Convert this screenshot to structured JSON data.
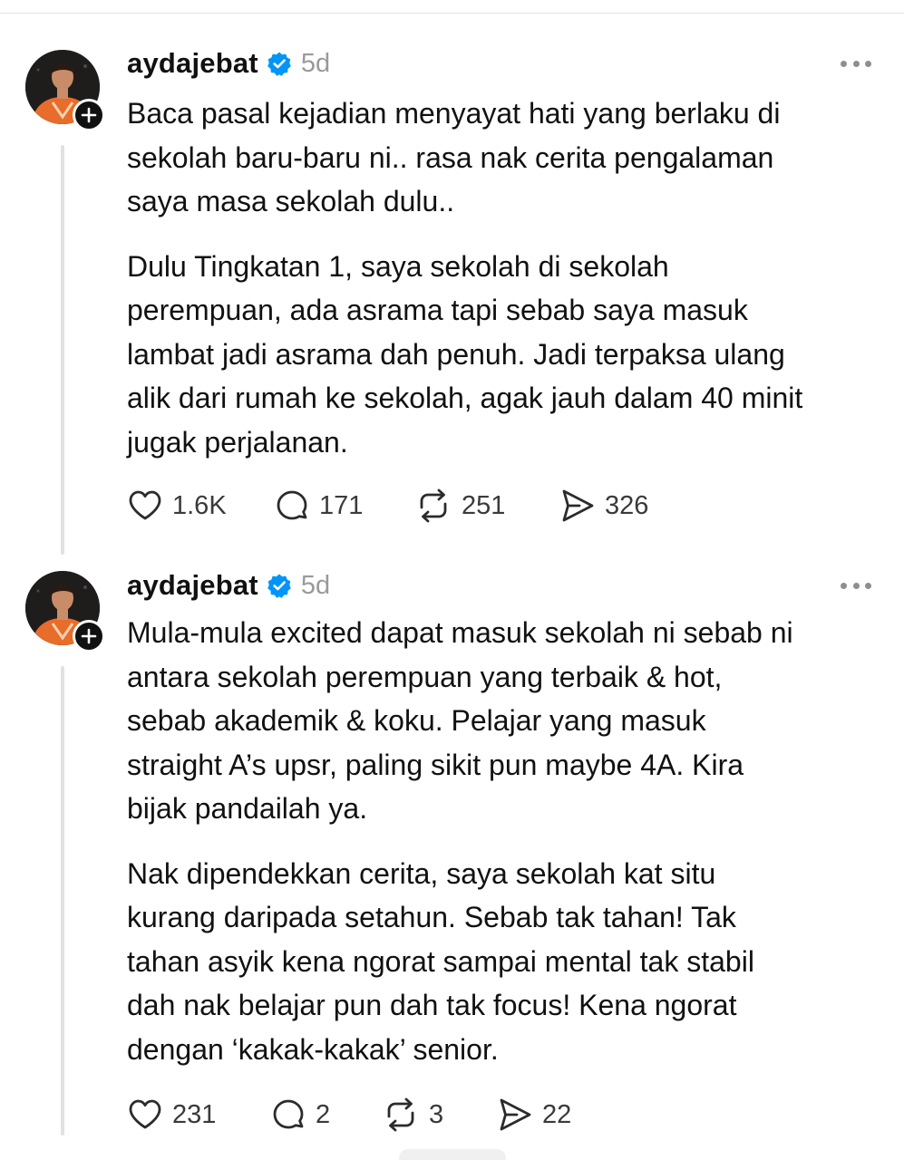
{
  "posts": [
    {
      "username": "aydajebat",
      "time": "5d",
      "paragraphs": [
        [
          "Baca pasal kejadian menyayat hati yang berlaku di",
          "sekolah baru-baru ni.. rasa nak cerita pengalaman",
          "saya masa sekolah dulu.."
        ],
        [
          "Dulu Tingkatan 1, saya sekolah di sekolah",
          "perempuan, ada asrama tapi sebab saya masuk",
          "lambat jadi asrama dah penuh. Jadi terpaksa ulang",
          "alik dari rumah ke sekolah, agak jauh dalam 40 minit",
          "jugak perjalanan."
        ]
      ],
      "likes": "1.6K",
      "replies": "171",
      "reposts": "251",
      "shares": "326"
    },
    {
      "username": "aydajebat",
      "time": "5d",
      "paragraphs": [
        [
          "Mula-mula excited dapat masuk sekolah ni sebab ni",
          "antara sekolah perempuan yang terbaik & hot,",
          "sebab akademik & koku. Pelajar yang masuk",
          "straight A’s upsr, paling sikit pun maybe 4A. Kira",
          "bijak pandailah ya."
        ],
        [
          "Nak dipendekkan cerita, saya sekolah kat situ",
          "kurang daripada setahun. Sebab tak tahan! Tak",
          "tahan asyik kena ngorat sampai mental tak stabil",
          "dah nak belajar pun dah tak focus! Kena ngorat",
          "dengan ‘kakak-kakak’ senior."
        ]
      ],
      "likes": "231",
      "replies": "2",
      "reposts": "3",
      "shares": "22"
    }
  ],
  "icons": {
    "like": "heart-icon",
    "reply": "comment-icon",
    "repost": "repost-icon",
    "share": "send-icon",
    "verified": "verified-badge-icon",
    "more": "more-options-icon",
    "follow": "plus-icon"
  },
  "colors": {
    "verified": "#0095f6",
    "text": "#111111",
    "muted": "#9a9a9a",
    "thread_line": "#e1e1e1"
  }
}
